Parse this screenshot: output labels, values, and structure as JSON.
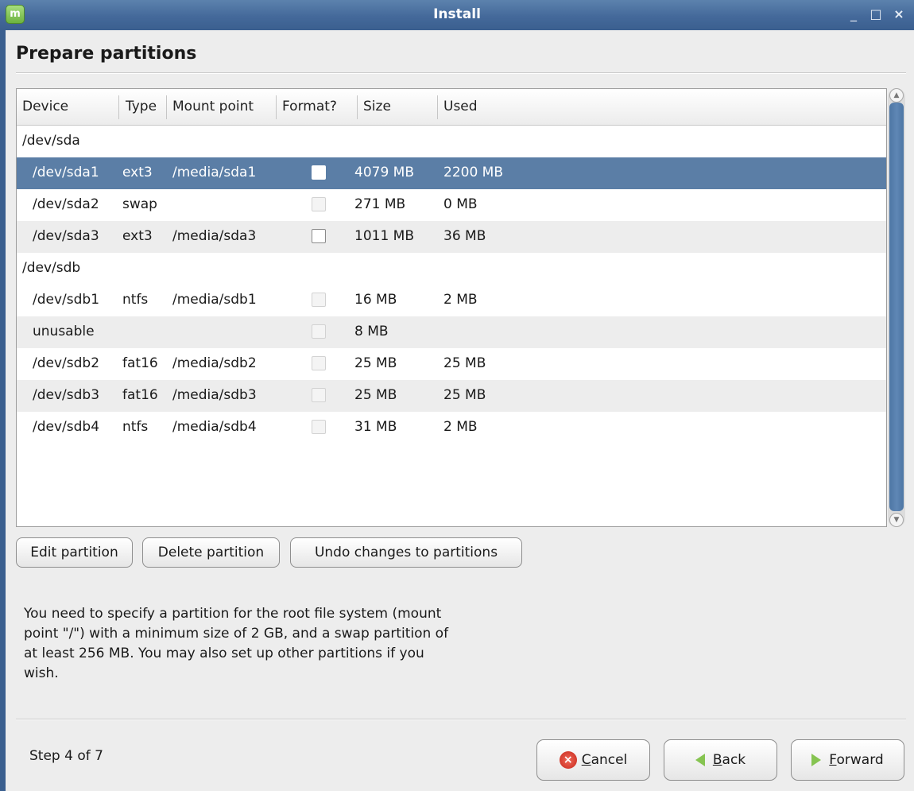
{
  "window": {
    "title": "Install",
    "minimize_glyph": "_",
    "maximize_glyph": "□",
    "close_glyph": "×"
  },
  "page_title": "Prepare partitions",
  "table": {
    "columns": [
      "Device",
      "Type",
      "Mount point",
      "Format?",
      "Size",
      "Used"
    ],
    "rows": [
      {
        "kind": "disk",
        "device": "/dev/sda"
      },
      {
        "kind": "partition",
        "device": "/dev/sda1",
        "type": "ext3",
        "mount": "/media/sda1",
        "format": false,
        "format_enabled": true,
        "size": "4079 MB",
        "used": "2200 MB",
        "selected": true
      },
      {
        "kind": "partition",
        "device": "/dev/sda2",
        "type": "swap",
        "mount": "",
        "format": false,
        "format_enabled": false,
        "size": "271 MB",
        "used": "0 MB",
        "selected": false
      },
      {
        "kind": "partition",
        "device": "/dev/sda3",
        "type": "ext3",
        "mount": "/media/sda3",
        "format": false,
        "format_enabled": true,
        "size": "1011 MB",
        "used": "36 MB",
        "selected": false
      },
      {
        "kind": "disk",
        "device": "/dev/sdb"
      },
      {
        "kind": "partition",
        "device": "/dev/sdb1",
        "type": "ntfs",
        "mount": "/media/sdb1",
        "format": false,
        "format_enabled": false,
        "size": "16 MB",
        "used": "2 MB",
        "selected": false
      },
      {
        "kind": "partition",
        "device": "unusable",
        "type": "",
        "mount": "",
        "format": false,
        "format_enabled": false,
        "size": "8 MB",
        "used": "",
        "selected": false
      },
      {
        "kind": "partition",
        "device": "/dev/sdb2",
        "type": "fat16",
        "mount": "/media/sdb2",
        "format": false,
        "format_enabled": false,
        "size": "25 MB",
        "used": "25 MB",
        "selected": false
      },
      {
        "kind": "partition",
        "device": "/dev/sdb3",
        "type": "fat16",
        "mount": "/media/sdb3",
        "format": false,
        "format_enabled": false,
        "size": "25 MB",
        "used": "25 MB",
        "selected": false
      },
      {
        "kind": "partition",
        "device": "/dev/sdb4",
        "type": "ntfs",
        "mount": "/media/sdb4",
        "format": false,
        "format_enabled": false,
        "size": "31 MB",
        "used": "2 MB",
        "selected": false
      }
    ]
  },
  "actions": {
    "edit": "Edit partition",
    "delete": "Delete partition",
    "undo": "Undo changes to partitions"
  },
  "info_text": "You need to specify a partition for the root file system (mount point \"/\") with a minimum size of 2 GB, and a swap partition of at least 256 MB. You may also set up other partitions if you wish.",
  "footer": {
    "step": "Step 4 of 7",
    "cancel_mnemonic": "C",
    "cancel_rest": "ancel",
    "back_mnemonic": "B",
    "back_rest": "ack",
    "forward_mnemonic": "F",
    "forward_rest": "orward"
  },
  "colors": {
    "selection": "#5b7ea6",
    "titlebar": "#44699a",
    "arrow_icon": "#86c451",
    "cancel_icon": "#d9362a"
  }
}
